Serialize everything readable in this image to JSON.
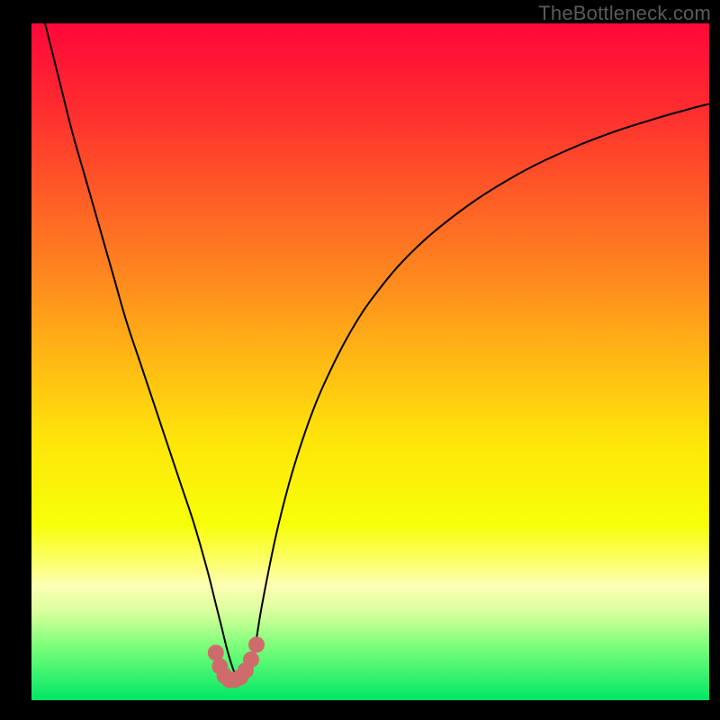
{
  "watermark": "TheBottleneck.com",
  "chart_data": {
    "type": "line",
    "title": "",
    "xlabel": "",
    "ylabel": "",
    "xlim": [
      0,
      100
    ],
    "ylim": [
      0,
      100
    ],
    "background": {
      "gradient_stops": [
        {
          "offset": 0.0,
          "color": "#ff073a"
        },
        {
          "offset": 0.12,
          "color": "#ff2b2f"
        },
        {
          "offset": 0.25,
          "color": "#ff5a27"
        },
        {
          "offset": 0.38,
          "color": "#ff8a1e"
        },
        {
          "offset": 0.5,
          "color": "#ffba14"
        },
        {
          "offset": 0.62,
          "color": "#ffe60a"
        },
        {
          "offset": 0.74,
          "color": "#f7ff08"
        },
        {
          "offset": 0.79,
          "color": "#faff60"
        },
        {
          "offset": 0.83,
          "color": "#feffb4"
        },
        {
          "offset": 0.87,
          "color": "#d8ff9c"
        },
        {
          "offset": 0.92,
          "color": "#7bff7a"
        },
        {
          "offset": 1.0,
          "color": "#00e765"
        }
      ]
    },
    "series": [
      {
        "name": "bottleneck-curve",
        "stroke": "#000000",
        "stroke_width": 2,
        "x": [
          2,
          4,
          6,
          8,
          10,
          12,
          14,
          16,
          18,
          20,
          22,
          24,
          26,
          27,
          28,
          29,
          30,
          31,
          32,
          33,
          34,
          36,
          38,
          40,
          42,
          44,
          46,
          48,
          50,
          54,
          58,
          62,
          66,
          70,
          74,
          78,
          82,
          86,
          90,
          94,
          98,
          100
        ],
        "y": [
          100,
          92,
          84,
          77,
          70,
          63,
          56,
          50,
          44,
          38,
          32,
          26,
          19,
          15,
          11,
          7,
          4,
          3,
          4,
          8,
          14,
          24,
          32,
          38.5,
          44,
          48.5,
          52.5,
          56,
          59,
          64,
          68,
          71.3,
          74.2,
          76.7,
          78.9,
          80.8,
          82.5,
          84,
          85.3,
          86.5,
          87.6,
          88.1
        ]
      },
      {
        "name": "sweet-spot-markers",
        "type": "scatter",
        "marker_color": "#cf6b6b",
        "marker_radius": 9,
        "x": [
          27.2,
          27.8,
          28.5,
          29.2,
          30.0,
          30.8,
          31.6,
          32.4,
          33.2
        ],
        "y": [
          7.0,
          5.0,
          3.6,
          3.0,
          3.0,
          3.4,
          4.4,
          6.0,
          8.2
        ]
      }
    ]
  }
}
